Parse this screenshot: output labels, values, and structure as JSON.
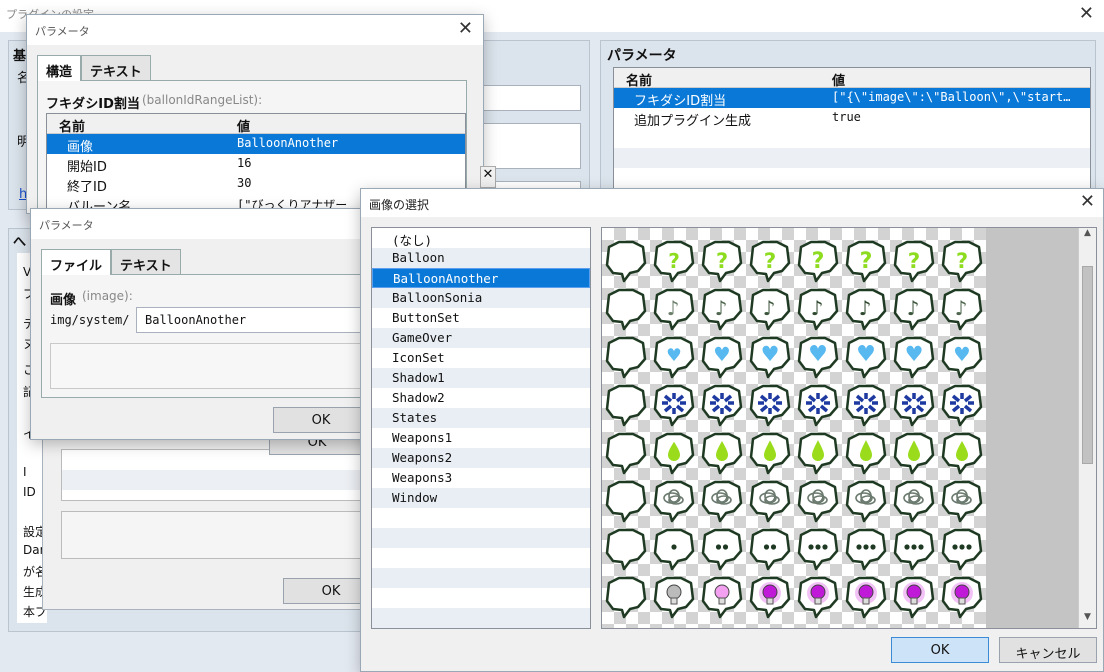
{
  "main_window": {
    "title": "プラグインの設定"
  },
  "bg_panel": {
    "section1": "基",
    "label_a": "名",
    "label_b": "明",
    "link": "h",
    "side_lines": [
      "V",
      "プ",
      "テ",
      "ヌ",
      "こ",
      "記",
      "イ",
      "",
      "I",
      "ID"
    ],
    "desc_lines": [
      "設定",
      "Dar",
      "が名",
      "生成",
      "本プ"
    ]
  },
  "right_panel": {
    "title": "パラメータ",
    "headers": {
      "name": "名前",
      "value": "値"
    },
    "rows": [
      {
        "name": "フキダシID割当",
        "value": "[\"{\\\"image\\\":\\\"Balloon\\\",\\\"start…"
      },
      {
        "name": "追加プラグイン生成",
        "value": "true"
      }
    ]
  },
  "param_dialog1": {
    "title": "パラメータ",
    "tabs": [
      "構造",
      "テキスト"
    ],
    "struct_label": "フキダシID割当",
    "struct_key": "(ballonIdRangeList):",
    "headers": {
      "name": "名前",
      "value": "値"
    },
    "rows": [
      {
        "name": "画像",
        "value": "BalloonAnother"
      },
      {
        "name": "開始ID",
        "value": "16"
      },
      {
        "name": "終了ID",
        "value": "30"
      },
      {
        "name": "バルーン名",
        "value": "[\"びっくりアナザー"
      }
    ],
    "ok_label": "OK"
  },
  "param_dialog2": {
    "title": "パラメータ",
    "tabs": [
      "ファイル",
      "テキスト"
    ],
    "image_label": "画像",
    "image_key": "(image):",
    "path_prefix": "img/system/",
    "file_value": "BalloonAnother",
    "ok_label": "OK"
  },
  "behind_ok": {
    "label1": "OK",
    "label2": "OK"
  },
  "image_picker": {
    "title": "画像の選択",
    "files": [
      "(なし)",
      "Balloon",
      "BalloonAnother",
      "BalloonSonia",
      "ButtonSet",
      "GameOver",
      "IconSet",
      "Shadow1",
      "Shadow2",
      "States",
      "Weapons1",
      "Weapons2",
      "Weapons3",
      "Window"
    ],
    "selected_index": 2,
    "ok_label": "OK",
    "cancel_label": "キャンセル",
    "preview_rows": [
      "question-mark-icon",
      "music-note-icon",
      "heart-icon",
      "anger-icon",
      "drop-icon",
      "scribble-icon",
      "ellipsis-icon",
      "lightbulb-icon"
    ],
    "colors": {
      "question": "#8ddc1f",
      "heart": "#58b8f0",
      "anger": "#1e3aa0",
      "drop": "#9adc1c",
      "bulb": "#c01ad8",
      "selection": "#0a78d7"
    }
  }
}
